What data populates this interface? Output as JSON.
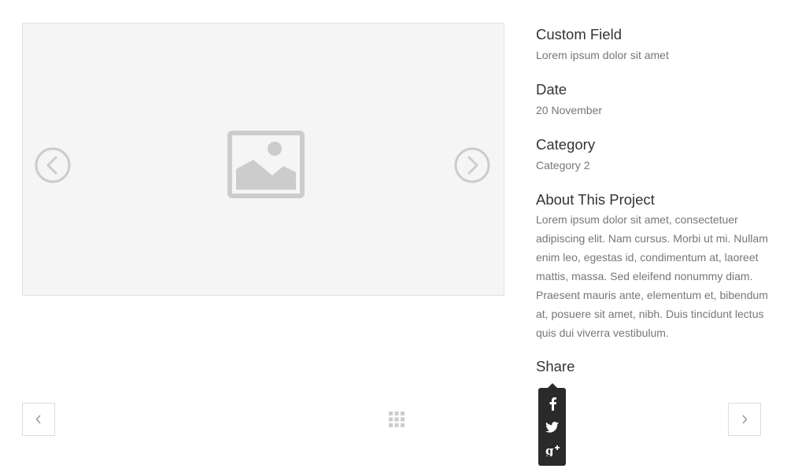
{
  "gallery": {
    "image_icon": "image-placeholder-icon",
    "prev_icon": "circle-chevron-left-icon",
    "next_icon": "circle-chevron-right-icon"
  },
  "details": {
    "custom_field": {
      "title": "Custom Field",
      "value": "Lorem ipsum dolor sit amet"
    },
    "date": {
      "title": "Date",
      "value": "20 November"
    },
    "category": {
      "title": "Category",
      "value": "Category 2"
    },
    "about": {
      "title": "About This Project",
      "value": "Lorem ipsum dolor sit amet, consectetuer adipiscing elit. Nam cursus. Morbi ut mi. Nullam enim leo, egestas id, condimentum at, laoreet mattis, massa. Sed eleifend nonummy diam. Praesent mauris ante, elementum et, bibendum at, posuere sit amet, nibh. Duis tincidunt lectus quis dui viverra vestibulum."
    },
    "share": {
      "title": "Share"
    }
  },
  "share_menu": {
    "items": [
      "facebook-icon",
      "twitter-icon",
      "google-plus-icon"
    ]
  },
  "navigation": {
    "prev_icon": "chevron-left-icon",
    "next_icon": "chevron-right-icon",
    "grid_icon": "grid-icon"
  },
  "colors": {
    "gallery_bg": "#f5f5f5",
    "icon_gray": "#cccccc",
    "menu_bg": "#2a2a2a",
    "text_dark": "#333333",
    "text_muted": "#777777"
  }
}
